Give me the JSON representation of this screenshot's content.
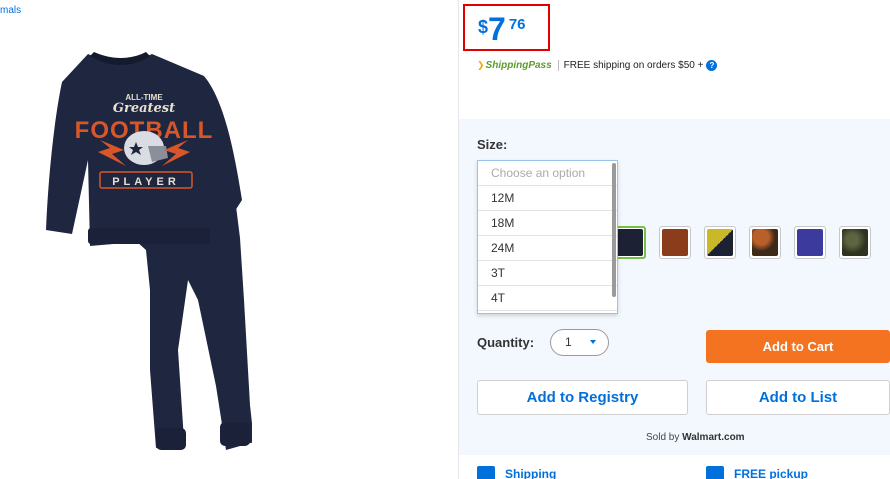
{
  "breadcrumb": {
    "text": "mals"
  },
  "product": {
    "image_alt_icon": "sweatsuit-image"
  },
  "price": {
    "currency": "$",
    "dollars": "7",
    "cents": "76"
  },
  "shipping_pass": {
    "logo_text": "ShippingPass",
    "text": "FREE shipping on orders $50 +"
  },
  "size": {
    "label": "Size:",
    "placeholder": "Choose an option",
    "options": [
      "12M",
      "18M",
      "24M",
      "3T",
      "4T"
    ]
  },
  "swatches": [
    {
      "name": "navy",
      "color": "#1c2133",
      "selected": true
    },
    {
      "name": "rust",
      "color": "#8a3c1b"
    },
    {
      "name": "yellow-navy",
      "color": "#c9b827"
    },
    {
      "name": "brown-orange",
      "color": "#6b3d1c"
    },
    {
      "name": "royal-purple",
      "color": "#3d3a9e"
    },
    {
      "name": "olive-camo",
      "color": "#3c4128"
    }
  ],
  "quantity": {
    "label": "Quantity:",
    "value": "1"
  },
  "buttons": {
    "add_to_cart": "Add to Cart",
    "add_to_registry": "Add to Registry",
    "add_to_list": "Add to List"
  },
  "sold_by": {
    "prefix": "Sold by",
    "seller": "Walmart.com"
  },
  "bottom_links": {
    "shipping": "Shipping",
    "pickup": "FREE pickup"
  },
  "colors": {
    "accent": "#0071dc",
    "cta": "#f47321",
    "price_box_border": "#e00000",
    "selected_swatch": "#76c043",
    "panel_bg": "#f2f8fd"
  }
}
